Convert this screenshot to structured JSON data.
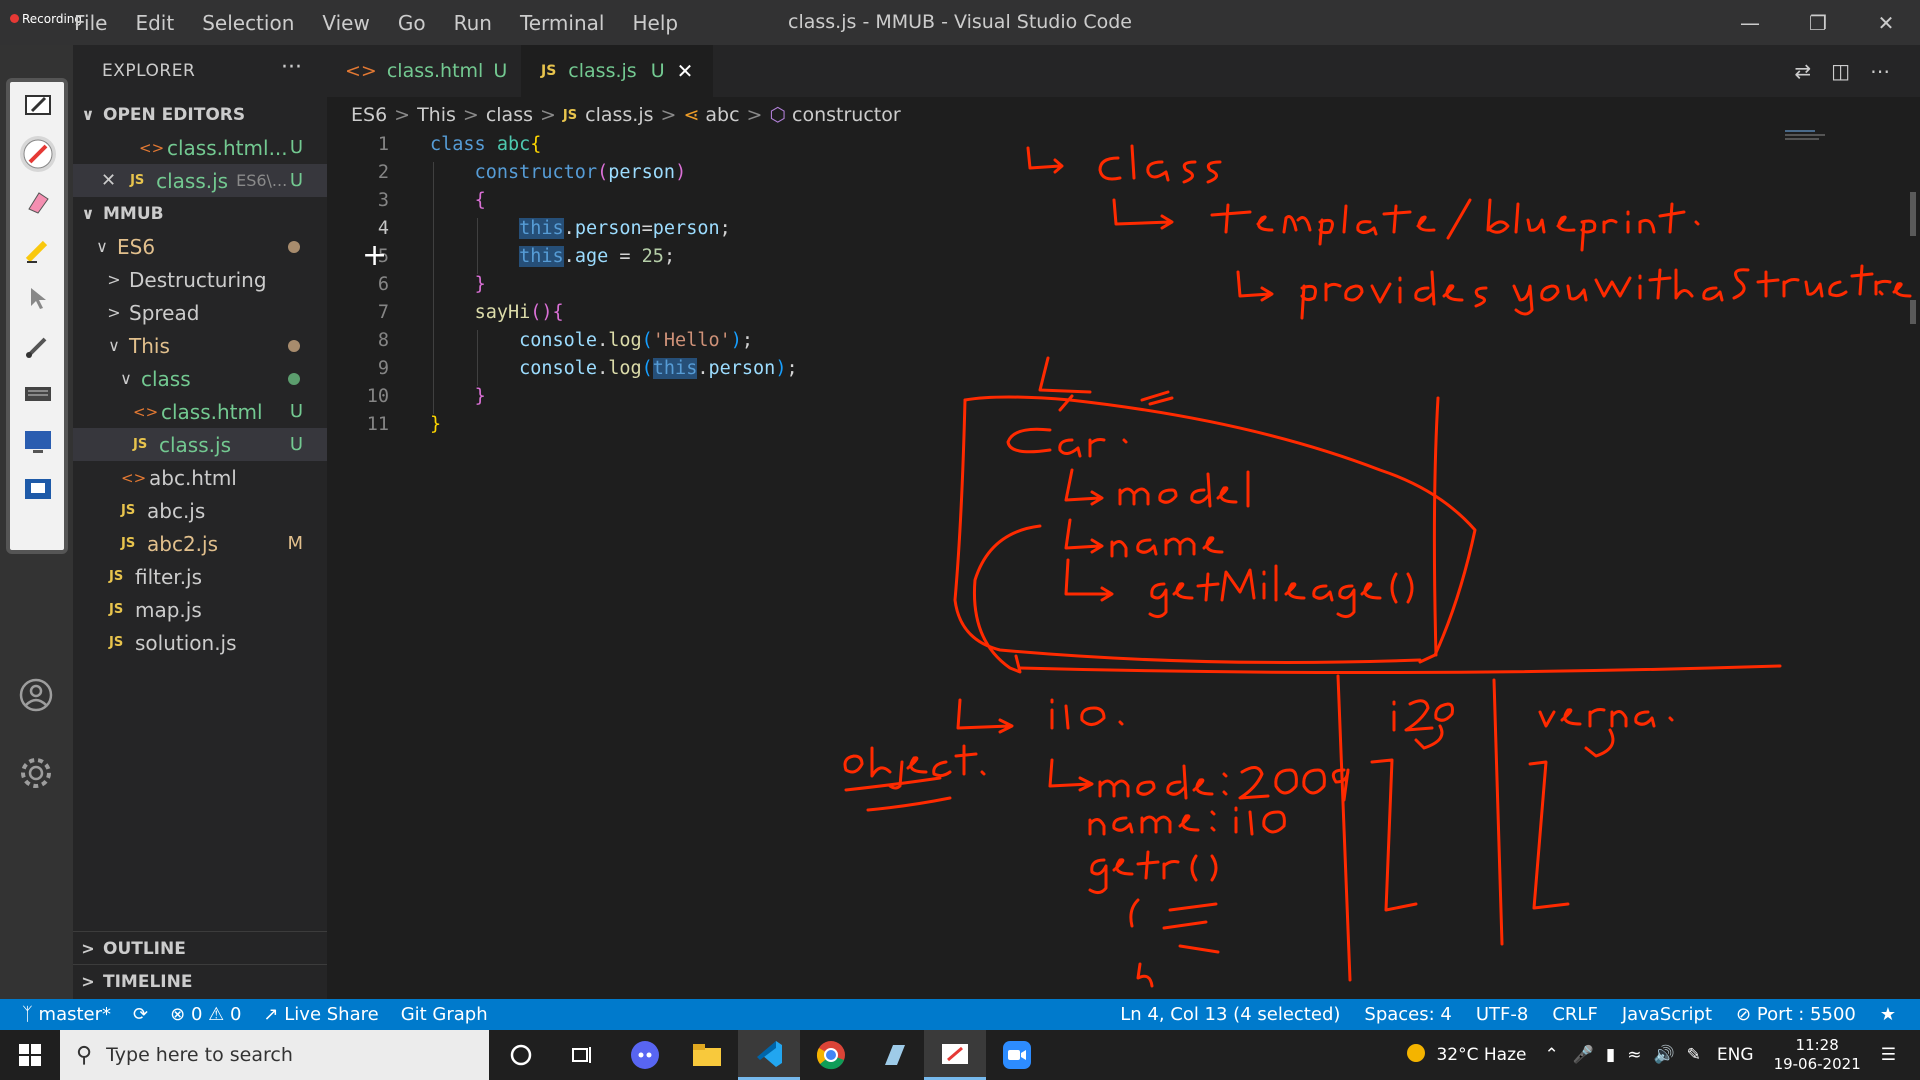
{
  "recording": {
    "label": "Recording"
  },
  "window": {
    "title": "class.js - MMUB - Visual Studio Code"
  },
  "menu": {
    "items": [
      "File",
      "Edit",
      "Selection",
      "View",
      "Go",
      "Run",
      "Terminal",
      "Help"
    ]
  },
  "explorer": {
    "title": "EXPLORER",
    "more": "···",
    "open_editors": {
      "label": "OPEN EDITORS",
      "items": [
        {
          "name": "class.html...",
          "status": "U"
        },
        {
          "name": "class.js",
          "path": "ES6\\...",
          "status": "U"
        }
      ]
    },
    "workspace": {
      "label": "MMUB",
      "tree": [
        {
          "name": "ES6"
        },
        {
          "name": "Destructuring"
        },
        {
          "name": "Spread"
        },
        {
          "name": "This"
        },
        {
          "name": "class"
        },
        {
          "name": "class.html",
          "status": "U"
        },
        {
          "name": "class.js",
          "status": "U"
        },
        {
          "name": "abc.html"
        },
        {
          "name": "abc.js"
        },
        {
          "name": "abc2.js",
          "status": "M"
        },
        {
          "name": "filter.js"
        },
        {
          "name": "map.js"
        },
        {
          "name": "solution.js"
        }
      ]
    },
    "outline": "OUTLINE",
    "timeline": "TIMELINE"
  },
  "tabs": [
    {
      "name": "class.html",
      "status": "U"
    },
    {
      "name": "class.js",
      "status": "U"
    }
  ],
  "breadcrumb": [
    "ES6",
    "This",
    "class",
    "class.js",
    "abc",
    "constructor"
  ],
  "code": {
    "line_numbers": [
      "1",
      "2",
      "3",
      "4",
      "5",
      "6",
      "7",
      "8",
      "9",
      "10",
      "11"
    ],
    "lines": [
      "class abc{",
      "    constructor(person)",
      "    {",
      "        this.person=person;",
      "        this.age = 25;",
      "    }",
      "    sayHi(){",
      "        console.log('Hello');",
      "        console.log(this.person);",
      "    }",
      "}"
    ]
  },
  "statusbar": {
    "branch": "master*",
    "errors": "0",
    "warnings": "0",
    "live_share": "Live Share",
    "git_graph": "Git Graph",
    "cursor": "Ln 4, Col 13 (4 selected)",
    "spaces": "Spaces: 4",
    "encoding": "UTF-8",
    "eol": "CRLF",
    "language": "JavaScript",
    "port": "Port : 5500"
  },
  "taskbar": {
    "search_placeholder": "Type here to search",
    "weather": "32°C  Haze",
    "lang": "ENG",
    "time": "11:28",
    "date": "19-06-2021"
  },
  "colors": {
    "accent": "#007acc",
    "ink": "#ff2a00",
    "untracked": "#73c991"
  }
}
